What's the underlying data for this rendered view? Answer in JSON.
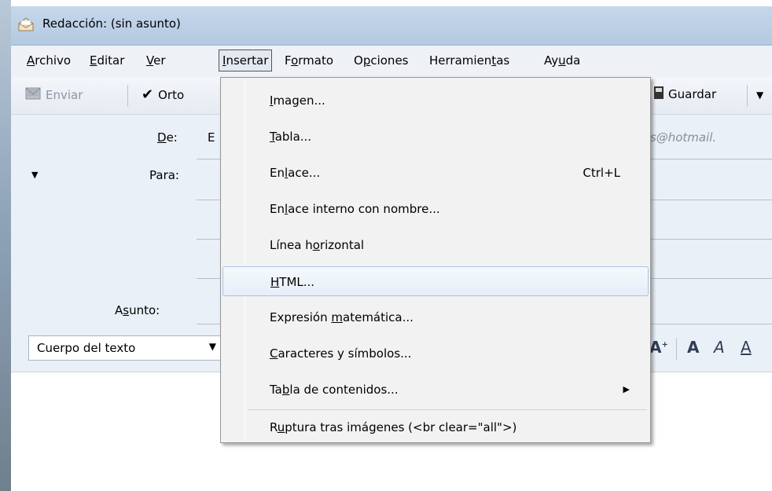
{
  "window": {
    "title": "Redacción: (sin asunto)"
  },
  "menubar": {
    "items": [
      {
        "label": "Archivo"
      },
      {
        "label": "Editar"
      },
      {
        "label": "Ver"
      },
      {
        "label": "Insertar"
      },
      {
        "label": "Formato"
      },
      {
        "label": "Opciones"
      },
      {
        "label": "Herramientas"
      },
      {
        "label": "Ayuda"
      }
    ]
  },
  "toolbar": {
    "send_label": "Enviar",
    "spell_label": "Orto",
    "save_label": "Guardar"
  },
  "header": {
    "from_label": "De:",
    "from_value": "E",
    "from_email_partial": "ines@hotmail.",
    "to_label": "Para:",
    "subject_label": "Asunto:"
  },
  "formatbar": {
    "style_value": "Cuerpo del texto"
  },
  "insert_menu": {
    "items": [
      {
        "label": "Imagen...",
        "shortcut": ""
      },
      {
        "label": "Tabla...",
        "shortcut": ""
      },
      {
        "label": "Enlace...",
        "shortcut": "Ctrl+L"
      },
      {
        "label": "Enlace interno con nombre...",
        "shortcut": ""
      },
      {
        "label": "Línea horizontal",
        "shortcut": ""
      },
      {
        "label": "HTML...",
        "shortcut": ""
      },
      {
        "label": "Expresión matemática...",
        "shortcut": ""
      },
      {
        "label": "Caracteres y símbolos...",
        "shortcut": ""
      },
      {
        "label": "Tabla de contenidos...",
        "shortcut": ""
      },
      {
        "label": "Ruptura tras imágenes (<br clear=\"all\">)",
        "shortcut": ""
      }
    ]
  }
}
